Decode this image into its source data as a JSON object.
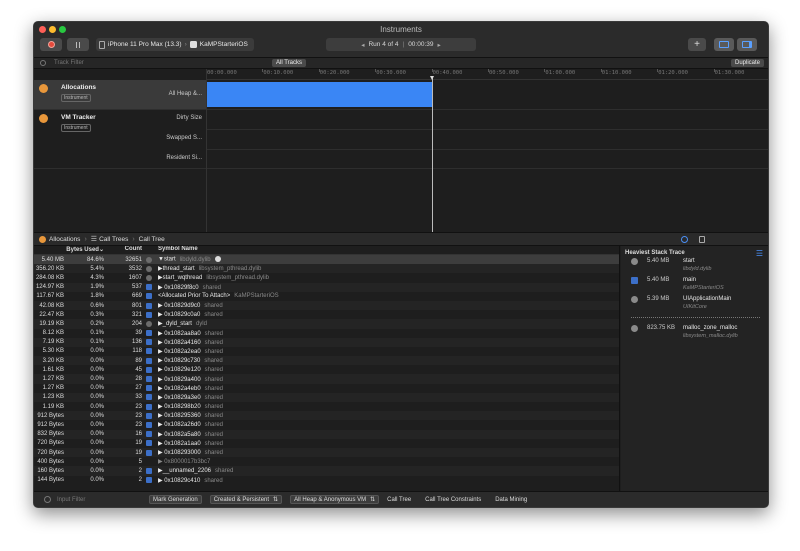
{
  "window": {
    "title": "Instruments"
  },
  "toolbar": {
    "device": "iPhone 11 Pro Max (13.3)",
    "app": "KaMPStarteriOS",
    "run_label": "Run 4 of 4",
    "run_time": "00:00:39",
    "add_symbol": "+"
  },
  "filterbar": {
    "placeholder": "Track Filter",
    "all_tracks": "All Tracks",
    "duplicate": "Duplicate"
  },
  "timeline": {
    "ticks": [
      "00:00.000",
      "00:10.000",
      "00:20.000",
      "00:30.000",
      "00:40.000",
      "00:50.000",
      "01:00.000",
      "01:10.000",
      "01:20.000",
      "01:30.000"
    ],
    "instruments": [
      {
        "name": "Allocations",
        "badge": "Instrument",
        "tracks": [
          "All Heap &..."
        ]
      },
      {
        "name": "VM Tracker",
        "badge": "Instrument",
        "tracks": [
          "Dirty Size",
          "Swapped S...",
          "Resident Si..."
        ]
      }
    ],
    "playhead_fraction": 0.4
  },
  "breadcrumb": {
    "root": "Allocations",
    "view": "Call Trees",
    "leaf": "Call Tree"
  },
  "table": {
    "headers": {
      "bytes": "Bytes Used",
      "count": "Count",
      "symbol": "Symbol Name"
    },
    "rows": [
      {
        "bytes": "5.40 MB",
        "pct": "84.6%",
        "count": "32651",
        "icon": "sys",
        "symbol": "▼start",
        "lib": "libdyld.dylib",
        "selected": true
      },
      {
        "bytes": "356.20 KB",
        "pct": "5.4%",
        "count": "3532",
        "icon": "sys",
        "symbol": "▶thread_start",
        "lib": "libsystem_pthread.dylib"
      },
      {
        "bytes": "284.08 KB",
        "pct": "4.3%",
        "count": "1607",
        "icon": "sys",
        "symbol": "▶start_wqthread",
        "lib": "libsystem_pthread.dylib"
      },
      {
        "bytes": "124.97 KB",
        "pct": "1.9%",
        "count": "537",
        "icon": "user",
        "symbol": "▶ 0x10829f8c0",
        "lib": "shared"
      },
      {
        "bytes": "117.67 KB",
        "pct": "1.8%",
        "count": "669",
        "icon": "user",
        "symbol": "<Allocated Prior To Attach>",
        "lib": "KaMPStarteriOS"
      },
      {
        "bytes": "42.08 KB",
        "pct": "0.6%",
        "count": "801",
        "icon": "user",
        "symbol": "▶ 0x10829d9c0",
        "lib": "shared"
      },
      {
        "bytes": "22.47 KB",
        "pct": "0.3%",
        "count": "321",
        "icon": "user",
        "symbol": "▶ 0x10829c0a0",
        "lib": "shared"
      },
      {
        "bytes": "19.19 KB",
        "pct": "0.2%",
        "count": "204",
        "icon": "sys",
        "symbol": "▶_dyld_start",
        "lib": "dyld"
      },
      {
        "bytes": "8.12 KB",
        "pct": "0.1%",
        "count": "39",
        "icon": "user",
        "symbol": "▶ 0x1082aa8a0",
        "lib": "shared"
      },
      {
        "bytes": "7.19 KB",
        "pct": "0.1%",
        "count": "136",
        "icon": "user",
        "symbol": "▶ 0x1082a4160",
        "lib": "shared"
      },
      {
        "bytes": "5.30 KB",
        "pct": "0.0%",
        "count": "118",
        "icon": "user",
        "symbol": "▶ 0x1082a2ea0",
        "lib": "shared"
      },
      {
        "bytes": "3.20 KB",
        "pct": "0.0%",
        "count": "89",
        "icon": "user",
        "symbol": "▶ 0x10829c730",
        "lib": "shared"
      },
      {
        "bytes": "1.61 KB",
        "pct": "0.0%",
        "count": "45",
        "icon": "user",
        "symbol": "▶ 0x10829e120",
        "lib": "shared"
      },
      {
        "bytes": "1.27 KB",
        "pct": "0.0%",
        "count": "28",
        "icon": "user",
        "symbol": "▶ 0x10829a400",
        "lib": "shared"
      },
      {
        "bytes": "1.27 KB",
        "pct": "0.0%",
        "count": "27",
        "icon": "user",
        "symbol": "▶ 0x1082a4eb0",
        "lib": "shared"
      },
      {
        "bytes": "1.23 KB",
        "pct": "0.0%",
        "count": "33",
        "icon": "user",
        "symbol": "▶ 0x10829a3e0",
        "lib": "shared"
      },
      {
        "bytes": "1.19 KB",
        "pct": "0.0%",
        "count": "23",
        "icon": "user",
        "symbol": "▶ 0x108298b20",
        "lib": "shared"
      },
      {
        "bytes": "912 Bytes",
        "pct": "0.0%",
        "count": "23",
        "icon": "user",
        "symbol": "▶ 0x108295360",
        "lib": "shared"
      },
      {
        "bytes": "912 Bytes",
        "pct": "0.0%",
        "count": "23",
        "icon": "user",
        "symbol": "▶ 0x1082a26d0",
        "lib": "shared"
      },
      {
        "bytes": "832 Bytes",
        "pct": "0.0%",
        "count": "16",
        "icon": "user",
        "symbol": "▶ 0x1082a5a80",
        "lib": "shared"
      },
      {
        "bytes": "720 Bytes",
        "pct": "0.0%",
        "count": "19",
        "icon": "user",
        "symbol": "▶ 0x1082a1aa0",
        "lib": "shared"
      },
      {
        "bytes": "720 Bytes",
        "pct": "0.0%",
        "count": "19",
        "icon": "user",
        "symbol": "▶ 0x108293000",
        "lib": "shared"
      },
      {
        "bytes": "400 Bytes",
        "pct": "0.0%",
        "count": "5",
        "icon": "none",
        "symbol": "▶ 0x8000017b3bc7",
        "lib": "",
        "dim": true
      },
      {
        "bytes": "160 Bytes",
        "pct": "0.0%",
        "count": "2",
        "icon": "user",
        "symbol": "▶__unnamed_2206",
        "lib": "shared"
      },
      {
        "bytes": "144 Bytes",
        "pct": "0.0%",
        "count": "2",
        "icon": "user",
        "symbol": "▶ 0x10829c410",
        "lib": "shared"
      }
    ]
  },
  "side": {
    "title": "Heaviest Stack Trace",
    "frames": [
      {
        "size": "5.40 MB",
        "name": "start",
        "lib": "libdyld.dylib",
        "icon": "sys"
      },
      {
        "size": "5.40 MB",
        "name": "main",
        "lib": "KaMPStarteriOS",
        "icon": "user"
      },
      {
        "size": "5.39 MB",
        "name": "UIApplicationMain",
        "lib": "UIKitCore",
        "icon": "sys"
      },
      {
        "size": "823.75 KB",
        "name": "malloc_zone_malloc",
        "lib": "libsystem_malloc.dylib",
        "icon": "sys"
      }
    ]
  },
  "bottombar": {
    "input_filter": "Input Filter",
    "mark_generation": "Mark Generation",
    "lifespan": "Created & Persistent",
    "allocation_type": "All Heap & Anonymous VM",
    "call_tree": "Call Tree",
    "constraints": "Call Tree Constraints",
    "data_mining": "Data Mining"
  }
}
